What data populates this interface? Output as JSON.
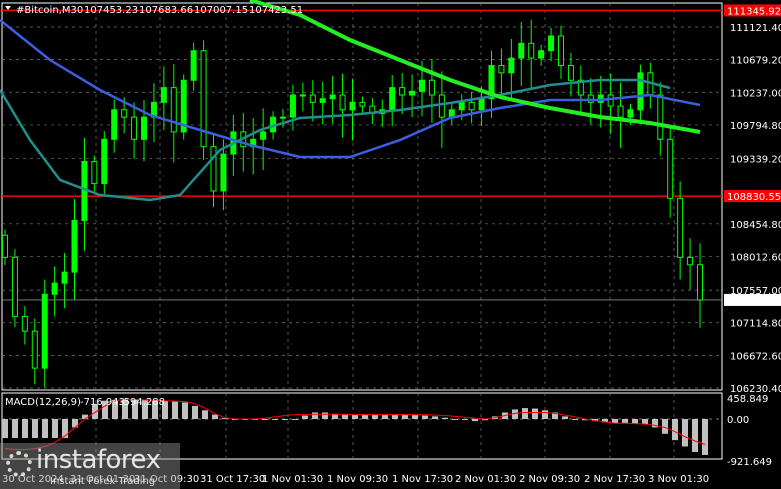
{
  "header": {
    "symbol": "#Bitcoin,M30",
    "open": "107453.23",
    "high": "107683.66",
    "low": "107007.15",
    "close": "107423.51"
  },
  "watermark": {
    "name": "instaforex",
    "tagline": "Instant Forex Trading"
  },
  "colors": {
    "bull": "#00ff00",
    "level": "#ff0000",
    "ma_fast": "#3c5fe0",
    "ma_mid": "#1f8f8f",
    "ma_slow": "#22ee22",
    "macd_hist": "#c0c0c0",
    "macd_signal": "#ff0000"
  },
  "chart_data": [
    {
      "type": "candlestick",
      "title": "#Bitcoin,M30",
      "ylim": [
        106230.4,
        111345.92
      ],
      "y_ticks": [
        "111121.40",
        "110679.20",
        "110237.00",
        "109794.80",
        "109339.20",
        "108454.80",
        "108012.60",
        "107557.00",
        "107114.80",
        "106672.60",
        "106230.40"
      ],
      "y_tick_values": [
        111121.4,
        110679.2,
        110237,
        109794.8,
        109339.2,
        108454.8,
        108012.6,
        107557,
        107114.8,
        106672.6,
        106230.4
      ],
      "x_ticks": [
        "30 Oct 2024",
        "31 Oct 01:30",
        "31 Oct 09:30",
        "31 Oct 17:30",
        "1 Nov 01:30",
        "1 Nov 09:30",
        "1 Nov 17:30",
        "2 Nov 01:30",
        "2 Nov 09:30",
        "2 Nov 17:30",
        "3 Nov 01:30"
      ],
      "levels": [
        {
          "label": "111345.92",
          "value": 111345.92
        },
        {
          "label": "108830.55",
          "value": 108830.55
        }
      ],
      "current_price": {
        "label": "107423.51",
        "value": 107423.51
      },
      "closes": [
        108000,
        107200,
        107000,
        106500,
        107500,
        107650,
        107800,
        108500,
        109300,
        109000,
        109600,
        110000,
        109900,
        109600,
        109900,
        110100,
        110300,
        109700,
        110400,
        110800,
        109500,
        108900,
        109400,
        109700,
        109500,
        109600,
        109700,
        109900,
        109900,
        110200,
        110200,
        110100,
        110150,
        110200,
        110000,
        110100,
        110050,
        109950,
        110000,
        110300,
        110200,
        110250,
        110400,
        110200,
        109900,
        110000,
        110100,
        110000,
        110150,
        110600,
        110500,
        110700,
        110900,
        110700,
        110800,
        111000,
        110600,
        110400,
        110200,
        110100,
        110200,
        110050,
        109900,
        110000,
        110500,
        110200,
        109600,
        108800,
        108000,
        107900,
        107423.51
      ],
      "series": [
        {
          "name": "MA fast",
          "color": "#3c5fe0",
          "points": [
            [
              0,
              111216
            ],
            [
              50,
              110674
            ],
            [
              100,
              110268
            ],
            [
              150,
              109929
            ],
            [
              200,
              109726
            ],
            [
              250,
              109523
            ],
            [
              300,
              109360
            ],
            [
              350,
              109360
            ],
            [
              400,
              109590
            ],
            [
              450,
              109889
            ],
            [
              500,
              110024
            ],
            [
              550,
              110132
            ],
            [
              600,
              110132
            ],
            [
              650,
              110200
            ],
            [
              700,
              110065
            ]
          ]
        },
        {
          "name": "MA mid",
          "color": "#1f8f8f",
          "points": [
            [
              0,
              110268
            ],
            [
              30,
              109590
            ],
            [
              60,
              109049
            ],
            [
              100,
              108845
            ],
            [
              150,
              108778
            ],
            [
              180,
              108845
            ],
            [
              220,
              109455
            ],
            [
              260,
              109726
            ],
            [
              300,
              109889
            ],
            [
              350,
              109929
            ],
            [
              400,
              109997
            ],
            [
              450,
              110092
            ],
            [
              500,
              110200
            ],
            [
              550,
              110335
            ],
            [
              600,
              110403
            ],
            [
              640,
              110403
            ],
            [
              670,
              110295
            ]
          ]
        },
        {
          "name": "MA slow",
          "color": "#22ee22",
          "points": [
            [
              250,
              111487
            ],
            [
              300,
              111284
            ],
            [
              350,
              110945
            ],
            [
              400,
              110674
            ],
            [
              450,
              110403
            ],
            [
              500,
              110173
            ],
            [
              550,
              110024
            ],
            [
              600,
              109902
            ],
            [
              650,
              109821
            ],
            [
              700,
              109699
            ]
          ]
        }
      ]
    },
    {
      "type": "bar",
      "title": "MACD(12,26,9) -716.943 -594.288",
      "label": "MACD(12,26,9)",
      "macd_value": "-716.943",
      "signal_value": "-594.288",
      "ylim": [
        -921.649,
        458.849
      ],
      "y_ticks": [
        "458.849",
        "0.00",
        "-921.649"
      ],
      "histogram": [
        -450,
        -450,
        -450,
        -450,
        -450,
        -450,
        -450,
        -200,
        100,
        350,
        420,
        440,
        450,
        450,
        440,
        420,
        420,
        400,
        380,
        300,
        200,
        100,
        20,
        0,
        0,
        0,
        0,
        0,
        0,
        0,
        80,
        150,
        150,
        120,
        100,
        100,
        100,
        100,
        100,
        100,
        100,
        90,
        80,
        60,
        30,
        0,
        -20,
        -50,
        -30,
        60,
        150,
        220,
        250,
        240,
        200,
        150,
        60,
        0,
        -30,
        -50,
        -80,
        -100,
        -100,
        -110,
        -120,
        -200,
        -350,
        -500,
        -650,
        -780,
        -850
      ],
      "signal": [
        -700,
        -720,
        -720,
        -700,
        -650,
        -550,
        -400,
        -200,
        0,
        150,
        300,
        420,
        450,
        450,
        440,
        430,
        420,
        410,
        400,
        350,
        250,
        120,
        30,
        0,
        0,
        0,
        20,
        50,
        80,
        100,
        100,
        110,
        110,
        110,
        110,
        100,
        100,
        100,
        100,
        100,
        100,
        100,
        100,
        90,
        80,
        60,
        40,
        20,
        0,
        30,
        80,
        130,
        150,
        150,
        150,
        130,
        90,
        50,
        0,
        -40,
        -70,
        -100,
        -100,
        -110,
        -120,
        -150,
        -200,
        -300,
        -420,
        -520,
        -600
      ]
    }
  ]
}
